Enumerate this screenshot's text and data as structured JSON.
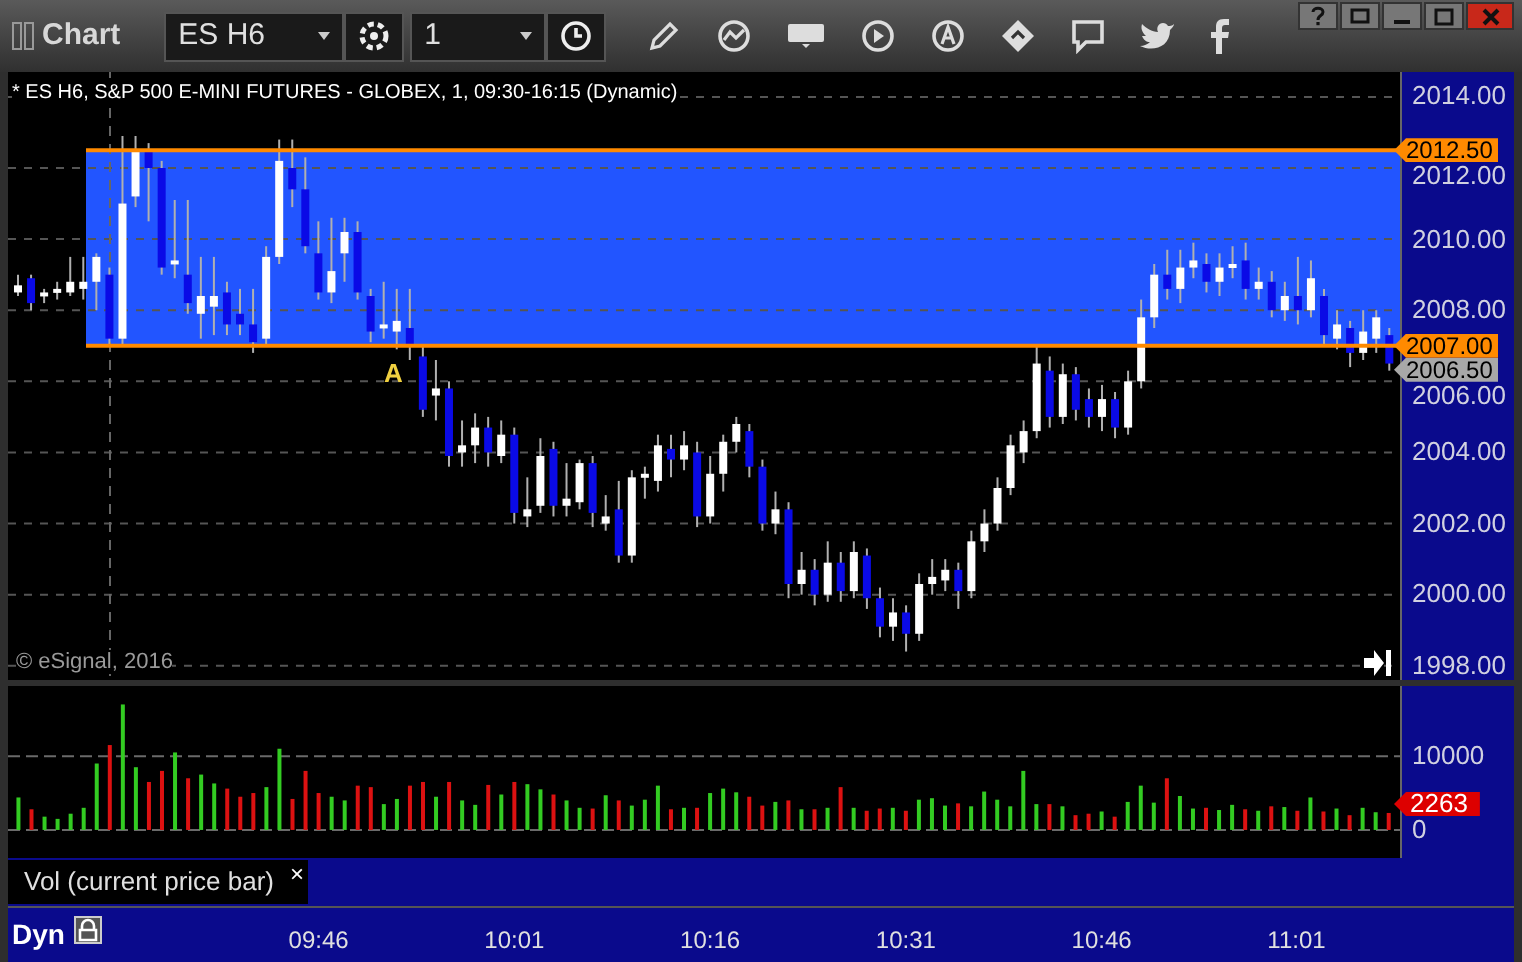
{
  "window": {
    "title": "Chart"
  },
  "toolbar": {
    "symbol": "ES H6",
    "interval": "1"
  },
  "price_pane": {
    "header": "* ES H6, S&P 500 E-MINI FUTURES - GLOBEX, 1, 09:30-16:15 (Dynamic)",
    "chart_data": {
      "type": "candlestick",
      "categories": [
        null,
        null,
        null,
        null,
        null,
        null,
        null,
        null,
        null,
        null,
        null,
        null,
        null,
        null,
        null,
        null,
        null,
        null,
        null,
        null,
        null,
        null,
        null,
        null,
        null,
        null,
        null,
        null,
        null,
        null,
        null,
        null,
        null,
        null,
        null,
        null,
        null,
        null,
        null,
        null,
        null,
        null,
        null,
        null,
        null,
        null,
        null,
        null,
        null,
        null,
        null,
        null,
        null,
        null,
        null,
        null,
        null,
        null,
        null,
        null,
        null,
        null,
        null,
        null,
        null,
        null,
        null,
        null,
        null,
        null,
        null,
        null,
        null,
        null,
        null,
        null,
        null,
        null,
        null,
        null,
        null,
        null,
        null,
        null,
        null,
        null,
        null,
        null,
        null,
        null,
        null,
        null,
        null,
        null,
        null,
        null,
        null,
        null,
        null,
        null,
        null,
        null,
        null,
        null,
        null,
        null
      ],
      "ylim": [
        1997.6,
        2014.7
      ],
      "grid": true,
      "bands": [
        {
          "axis": "y",
          "from": 2007,
          "to": 2012.5,
          "color": "#2255ff"
        }
      ],
      "ref_lines": [
        {
          "axis": "y",
          "value": 2012.5,
          "color": "#ff8a00"
        },
        {
          "axis": "y",
          "value": 2007,
          "color": "#ff8a00"
        }
      ],
      "ohlc": [
        [
          2008.5,
          2009.0,
          2008.4,
          2008.7
        ],
        [
          2008.9,
          2009.0,
          2008.0,
          2008.2
        ],
        [
          2008.4,
          2008.6,
          2008.2,
          2008.5
        ],
        [
          2008.5,
          2008.8,
          2008.3,
          2008.6
        ],
        [
          2008.5,
          2009.5,
          2008.4,
          2008.8
        ],
        [
          2008.6,
          2009.5,
          2008.3,
          2008.8
        ],
        [
          2008.8,
          2009.6,
          2008.0,
          2009.5
        ],
        [
          2009.0,
          2009.2,
          2007.0,
          2007.2
        ],
        [
          2007.2,
          2012.9,
          2007.0,
          2011.0
        ],
        [
          2011.2,
          2012.9,
          2010.9,
          2012.5
        ],
        [
          2012.5,
          2012.7,
          2010.5,
          2012.0
        ],
        [
          2012.0,
          2012.2,
          2009.0,
          2009.2
        ],
        [
          2009.3,
          2011.1,
          2008.9,
          2009.4
        ],
        [
          2009.0,
          2011.1,
          2007.9,
          2008.2
        ],
        [
          2007.9,
          2009.5,
          2007.2,
          2008.4
        ],
        [
          2008.1,
          2009.5,
          2007.3,
          2008.4
        ],
        [
          2008.5,
          2008.8,
          2007.3,
          2007.6
        ],
        [
          2007.9,
          2008.6,
          2007.3,
          2007.6
        ],
        [
          2007.6,
          2008.6,
          2006.8,
          2007.1
        ],
        [
          2007.2,
          2009.8,
          2007.0,
          2009.5
        ],
        [
          2009.5,
          2012.8,
          2009.3,
          2012.2
        ],
        [
          2012.0,
          2012.8,
          2010.9,
          2011.4
        ],
        [
          2011.4,
          2012.3,
          2009.6,
          2009.8
        ],
        [
          2009.6,
          2010.5,
          2008.3,
          2008.5
        ],
        [
          2008.5,
          2010.6,
          2008.2,
          2009.1
        ],
        [
          2009.6,
          2010.6,
          2008.8,
          2010.2
        ],
        [
          2010.2,
          2010.5,
          2008.3,
          2008.5
        ],
        [
          2008.4,
          2008.6,
          2007.1,
          2007.4
        ],
        [
          2007.5,
          2008.8,
          2007.2,
          2007.6
        ],
        [
          2007.4,
          2008.6,
          2006.9,
          2007.7
        ],
        [
          2007.5,
          2008.6,
          2006.6,
          2007.0
        ],
        [
          2006.7,
          2007.0,
          2005.0,
          2005.2
        ],
        [
          2005.6,
          2006.6,
          2004.9,
          2005.8
        ],
        [
          2005.8,
          2006.0,
          2003.6,
          2003.9
        ],
        [
          2004.0,
          2004.9,
          2003.6,
          2004.2
        ],
        [
          2004.2,
          2005.1,
          2003.7,
          2004.7
        ],
        [
          2004.7,
          2005.0,
          2003.6,
          2004.0
        ],
        [
          2003.9,
          2004.9,
          2003.7,
          2004.5
        ],
        [
          2004.5,
          2004.7,
          2002.0,
          2002.3
        ],
        [
          2002.2,
          2003.3,
          2001.9,
          2002.4
        ],
        [
          2002.5,
          2004.4,
          2002.3,
          2003.9
        ],
        [
          2004.1,
          2004.3,
          2002.2,
          2002.5
        ],
        [
          2002.5,
          2003.7,
          2002.2,
          2002.7
        ],
        [
          2002.6,
          2003.8,
          2002.4,
          2003.7
        ],
        [
          2003.7,
          2003.9,
          2001.9,
          2002.3
        ],
        [
          2002.0,
          2002.8,
          2001.8,
          2002.2
        ],
        [
          2002.4,
          2003.2,
          2000.9,
          2001.1
        ],
        [
          2001.1,
          2003.5,
          2000.9,
          2003.3
        ],
        [
          2003.3,
          2003.6,
          2002.7,
          2003.4
        ],
        [
          2003.2,
          2004.5,
          2002.9,
          2004.2
        ],
        [
          2004.1,
          2004.5,
          2003.3,
          2003.8
        ],
        [
          2003.8,
          2004.6,
          2003.5,
          2004.2
        ],
        [
          2004.0,
          2004.3,
          2001.9,
          2002.2
        ],
        [
          2002.2,
          2003.9,
          2002.0,
          2003.4
        ],
        [
          2003.4,
          2004.5,
          2002.9,
          2004.3
        ],
        [
          2004.3,
          2005.0,
          2004.0,
          2004.8
        ],
        [
          2004.6,
          2004.8,
          2003.3,
          2003.6
        ],
        [
          2003.6,
          2003.8,
          2001.8,
          2002.0
        ],
        [
          2002.0,
          2002.9,
          2001.7,
          2002.4
        ],
        [
          2002.4,
          2002.6,
          1999.9,
          2000.3
        ],
        [
          2000.3,
          2001.2,
          2000.0,
          2000.7
        ],
        [
          2000.7,
          2001.0,
          1999.7,
          2000.0
        ],
        [
          2000.0,
          2001.5,
          1999.8,
          2000.9
        ],
        [
          2000.9,
          2001.2,
          1999.8,
          2000.1
        ],
        [
          2000.1,
          2001.5,
          1999.9,
          2001.2
        ],
        [
          2001.1,
          2001.3,
          1999.6,
          1999.9
        ],
        [
          1999.9,
          2000.2,
          1998.8,
          1999.1
        ],
        [
          1999.1,
          1999.9,
          1998.7,
          1999.5
        ],
        [
          1999.5,
          1999.7,
          1998.4,
          1998.9
        ],
        [
          1998.9,
          2000.6,
          1998.7,
          2000.3
        ],
        [
          2000.3,
          2001.0,
          2000.0,
          2000.5
        ],
        [
          2000.4,
          2001.0,
          2000.1,
          2000.7
        ],
        [
          2000.7,
          2000.9,
          1999.6,
          2000.1
        ],
        [
          2000.1,
          2001.8,
          1999.9,
          2001.5
        ],
        [
          2001.5,
          2002.4,
          2001.2,
          2002.0
        ],
        [
          2002.0,
          2003.3,
          2001.8,
          2003.0
        ],
        [
          2003.0,
          2004.5,
          2002.8,
          2004.2
        ],
        [
          2004.0,
          2004.9,
          2003.7,
          2004.6
        ],
        [
          2004.6,
          2007.0,
          2004.4,
          2006.5
        ],
        [
          2006.3,
          2006.7,
          2004.7,
          2005.0
        ],
        [
          2005.0,
          2006.5,
          2004.8,
          2006.2
        ],
        [
          2006.2,
          2006.4,
          2004.9,
          2005.2
        ],
        [
          2005.5,
          2005.8,
          2004.7,
          2005.0
        ],
        [
          2005.0,
          2005.9,
          2004.6,
          2005.5
        ],
        [
          2005.5,
          2005.7,
          2004.4,
          2004.7
        ],
        [
          2004.7,
          2006.3,
          2004.5,
          2006.0
        ],
        [
          2006.0,
          2008.3,
          2005.8,
          2007.8
        ],
        [
          2007.8,
          2009.3,
          2007.5,
          2009.0
        ],
        [
          2009.0,
          2009.7,
          2008.3,
          2008.6
        ],
        [
          2008.6,
          2009.7,
          2008.2,
          2009.2
        ],
        [
          2009.2,
          2009.9,
          2008.9,
          2009.4
        ],
        [
          2009.3,
          2009.6,
          2008.5,
          2008.8
        ],
        [
          2008.8,
          2009.6,
          2008.4,
          2009.2
        ],
        [
          2009.2,
          2009.8,
          2008.9,
          2009.3
        ],
        [
          2009.4,
          2009.9,
          2008.3,
          2008.6
        ],
        [
          2008.6,
          2009.2,
          2008.3,
          2008.8
        ],
        [
          2008.8,
          2009.1,
          2007.8,
          2008.0
        ],
        [
          2008.0,
          2008.8,
          2007.7,
          2008.4
        ],
        [
          2008.4,
          2009.5,
          2007.6,
          2008.0
        ],
        [
          2008.0,
          2009.4,
          2007.8,
          2008.9
        ],
        [
          2008.4,
          2008.6,
          2007.0,
          2007.3
        ],
        [
          2007.2,
          2008.0,
          2006.9,
          2007.6
        ],
        [
          2007.5,
          2007.7,
          2006.4,
          2006.8
        ],
        [
          2006.8,
          2008.0,
          2006.6,
          2007.4
        ],
        [
          2007.2,
          2008.0,
          2006.8,
          2007.8
        ],
        [
          2007.3,
          2007.5,
          2006.3,
          2006.5
        ]
      ],
      "yticks": [
        {
          "value": 2014,
          "label": "2014.00"
        },
        {
          "value": 2012,
          "label": "2012.00"
        },
        {
          "value": 2010,
          "label": "2010.00"
        },
        {
          "value": 2008,
          "label": "2008.00"
        },
        {
          "value": 2006,
          "label": "2006.00"
        },
        {
          "value": 2004,
          "label": "2004.00"
        },
        {
          "value": 2002,
          "label": "2002.00"
        },
        {
          "value": 2000,
          "label": "2000.00"
        },
        {
          "value": 1998,
          "label": "1998.00"
        }
      ]
    },
    "price_tags": [
      {
        "text": "2012.50",
        "color": "#ff8a00"
      },
      {
        "text": "2007.00",
        "color": "#ff8a00"
      },
      {
        "text": "2006.50",
        "color": "#a8a8a8"
      }
    ],
    "marker": "A",
    "copyright": "© eSignal, 2016"
  },
  "volume_pane": {
    "chart_data": {
      "type": "bar",
      "stacked": true,
      "xlim": [
        562.2,
        677.6
      ],
      "ylim": [
        -3800,
        19500
      ],
      "grid": true,
      "x": [
        563,
        564,
        565,
        566,
        567,
        568,
        569,
        570,
        571,
        572,
        573,
        574,
        575,
        576,
        577,
        578,
        579,
        580,
        581,
        582,
        583,
        584,
        585,
        586,
        587,
        588,
        589,
        590,
        591,
        592,
        593,
        594,
        595,
        596,
        597,
        598,
        599,
        600,
        601,
        602,
        603,
        604,
        605,
        606,
        607,
        608,
        609,
        610,
        611,
        612,
        613,
        614,
        615,
        616,
        617,
        618,
        619,
        620,
        621,
        622,
        623,
        624,
        625,
        626,
        627,
        628,
        629,
        630,
        631,
        632,
        633,
        634,
        635,
        636,
        637,
        638,
        639,
        640,
        641,
        642,
        643,
        644,
        645,
        646,
        647,
        648,
        649,
        650,
        651,
        652,
        653,
        654,
        655,
        656,
        657,
        658,
        659,
        660,
        661,
        662,
        663,
        664,
        665,
        666,
        667,
        668
      ],
      "series": [
        {
          "name": "Vol (current price bar)",
          "color": "#33cc22",
          "values": [
            4400,
            null,
            1800,
            1500,
            2200,
            3000,
            9000,
            null,
            17000,
            8500,
            null,
            null,
            10500,
            null,
            7500,
            6300,
            null,
            null,
            null,
            5800,
            11000,
            null,
            null,
            null,
            4500,
            4000,
            null,
            null,
            3500,
            4200,
            null,
            null,
            4500,
            null,
            4000,
            3400,
            null,
            4800,
            null,
            6200,
            5500,
            null,
            4000,
            3000,
            null,
            4700,
            null,
            3300,
            4100,
            6000,
            null,
            3000,
            null,
            5000,
            5600,
            5100,
            null,
            null,
            3800,
            null,
            2800,
            null,
            3000,
            null,
            3000,
            null,
            null,
            3000,
            null,
            4100,
            4300,
            3300,
            null,
            3200,
            5200,
            4100,
            3200,
            8000,
            3500,
            null,
            3200,
            null,
            null,
            2500,
            null,
            3800,
            6000,
            3700,
            null,
            4600,
            2900,
            null,
            2700,
            3400,
            null,
            2600,
            null,
            3100,
            null,
            4400,
            null,
            2900,
            null,
            3000,
            2400,
            null
          ]
        },
        {
          "color": "#dd1111",
          "values": [
            null,
            2800,
            null,
            null,
            null,
            null,
            null,
            11500,
            null,
            null,
            6500,
            8000,
            null,
            7000,
            null,
            null,
            5600,
            4500,
            5000,
            null,
            null,
            4200,
            8000,
            5000,
            null,
            null,
            6000,
            5800,
            null,
            null,
            6000,
            6500,
            null,
            6500,
            null,
            null,
            6100,
            null,
            6500,
            null,
            null,
            4800,
            null,
            null,
            2900,
            null,
            4000,
            null,
            null,
            null,
            2800,
            null,
            3000,
            null,
            null,
            null,
            4500,
            3300,
            null,
            4000,
            null,
            2800,
            null,
            5800,
            null,
            2600,
            2900,
            null,
            2600,
            null,
            null,
            null,
            3600,
            null,
            null,
            null,
            null,
            null,
            null,
            3500,
            null,
            2000,
            2200,
            null,
            1800,
            null,
            null,
            null,
            7000,
            null,
            null,
            3000,
            null,
            null,
            2800,
            null,
            3200,
            null,
            2600,
            null,
            2500,
            null,
            2000,
            null,
            null,
            2300
          ]
        }
      ],
      "yticks": [
        {
          "value": 10000,
          "label": "10000"
        },
        {
          "value": 0,
          "label": "0"
        }
      ],
      "xticks": [
        {
          "value": 586,
          "label": "09:46"
        },
        {
          "value": 601,
          "label": "10:01"
        },
        {
          "value": 616,
          "label": "10:16"
        },
        {
          "value": 631,
          "label": "10:31"
        },
        {
          "value": 646,
          "label": "10:46"
        },
        {
          "value": 661,
          "label": "11:01"
        }
      ]
    },
    "tag": {
      "text": "2263",
      "color": "#dd0000"
    },
    "legend_close": "×"
  },
  "time_axis": {
    "mode": "Dyn"
  }
}
